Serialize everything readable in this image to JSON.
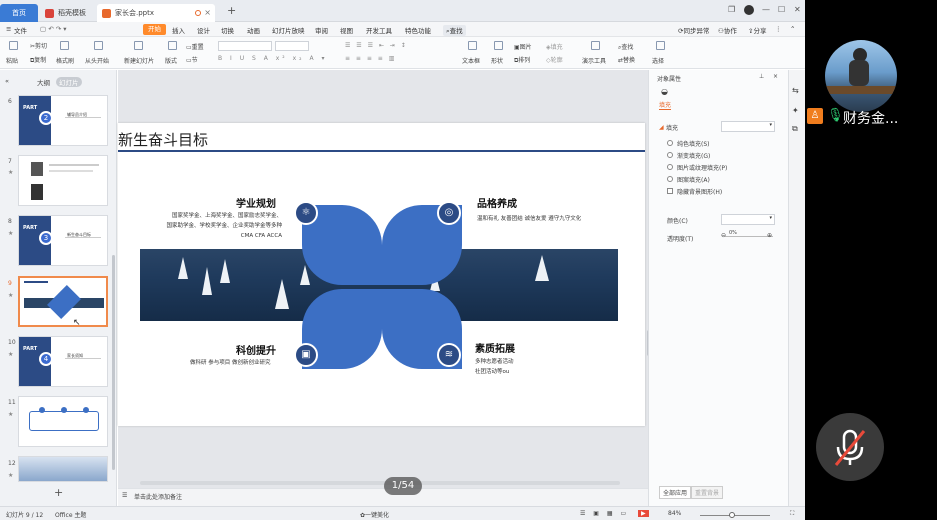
{
  "tabs": {
    "home": "首页",
    "doc1": "稻壳模板",
    "ppt": "家长会.pptx"
  },
  "menu": {
    "file": "文件",
    "items": [
      "开始",
      "插入",
      "设计",
      "切换",
      "动画",
      "幻灯片放映",
      "审阅",
      "视图",
      "开发工具",
      "特色功能"
    ],
    "search": "查找",
    "sync": "同步异常",
    "collab": "协作",
    "share": "分享"
  },
  "ribbon": {
    "paste": "粘贴",
    "cut": "剪切",
    "copy": "复制",
    "format_painter": "格式刷",
    "from_start": "从头开始",
    "new_slide": "新建幻灯片",
    "layout": "版式",
    "section": "节",
    "reset": "重置",
    "text_box": "文本框",
    "shape": "形状",
    "arrange": "排列",
    "picture": "图片",
    "fill": "填充",
    "outline": "轮廓",
    "present_tools": "演示工具",
    "find": "查找",
    "replace": "替换",
    "select": "选择"
  },
  "left": {
    "outline_tab": "大纲",
    "slides_tab": "幻灯片",
    "add": "+"
  },
  "thumbs": [
    {
      "num": "6",
      "part": "PART",
      "circle": "2",
      "text": "辅导员介绍"
    },
    {
      "num": "7"
    },
    {
      "num": "8",
      "part": "PART",
      "circle": "3",
      "text": "新生奋斗目标"
    },
    {
      "num": "9"
    },
    {
      "num": "10",
      "part": "PART",
      "circle": "4",
      "text": "家长须知"
    },
    {
      "num": "11"
    },
    {
      "num": "12"
    }
  ],
  "slide": {
    "title": "新生奋斗目标",
    "q1": {
      "title": "学业规划",
      "lines": [
        "国家奖学金、上海奖学金、国家励志奖学金、",
        "国家助学金、学校奖学金、企业奖助学金等多种",
        "CMA CFA    ACCA"
      ],
      "icon": "⚛"
    },
    "q2": {
      "title": "品格养成",
      "lines": [
        "温和有礼  友善团结  诚信友爱  遵守九守文化"
      ],
      "icon": "◎"
    },
    "q3": {
      "title": "科创提升",
      "lines": [
        "做科研 参与项目 做创新创业研究"
      ],
      "icon": "▣"
    },
    "q4": {
      "title": "素质拓展",
      "lines": [
        "多种志愿者活动",
        "社团活动等ou"
      ],
      "icon": "≋"
    }
  },
  "page_indicator": "1/54",
  "notes_placeholder": "单击此处添加备注",
  "right": {
    "panel_title": "对象属性",
    "fill_tab": "填充",
    "fill_section": "填充",
    "options": [
      "纯色填充(S)",
      "渐变填充(G)",
      "图片或纹理填充(P)",
      "图案填充(A)"
    ],
    "hide_bg": "隐藏背景图形(H)",
    "color_label": "颜色(C)",
    "transparency_label": "透明度(T)",
    "transparency_value": "0%",
    "apply_all": "全部应用",
    "reset_bg": "重置背景"
  },
  "status": {
    "slide_info": "幻灯片 9 / 12",
    "theme": "Office 主题",
    "beautify": "一键美化",
    "zoom": "84%"
  },
  "video": {
    "name": "财务金..."
  }
}
